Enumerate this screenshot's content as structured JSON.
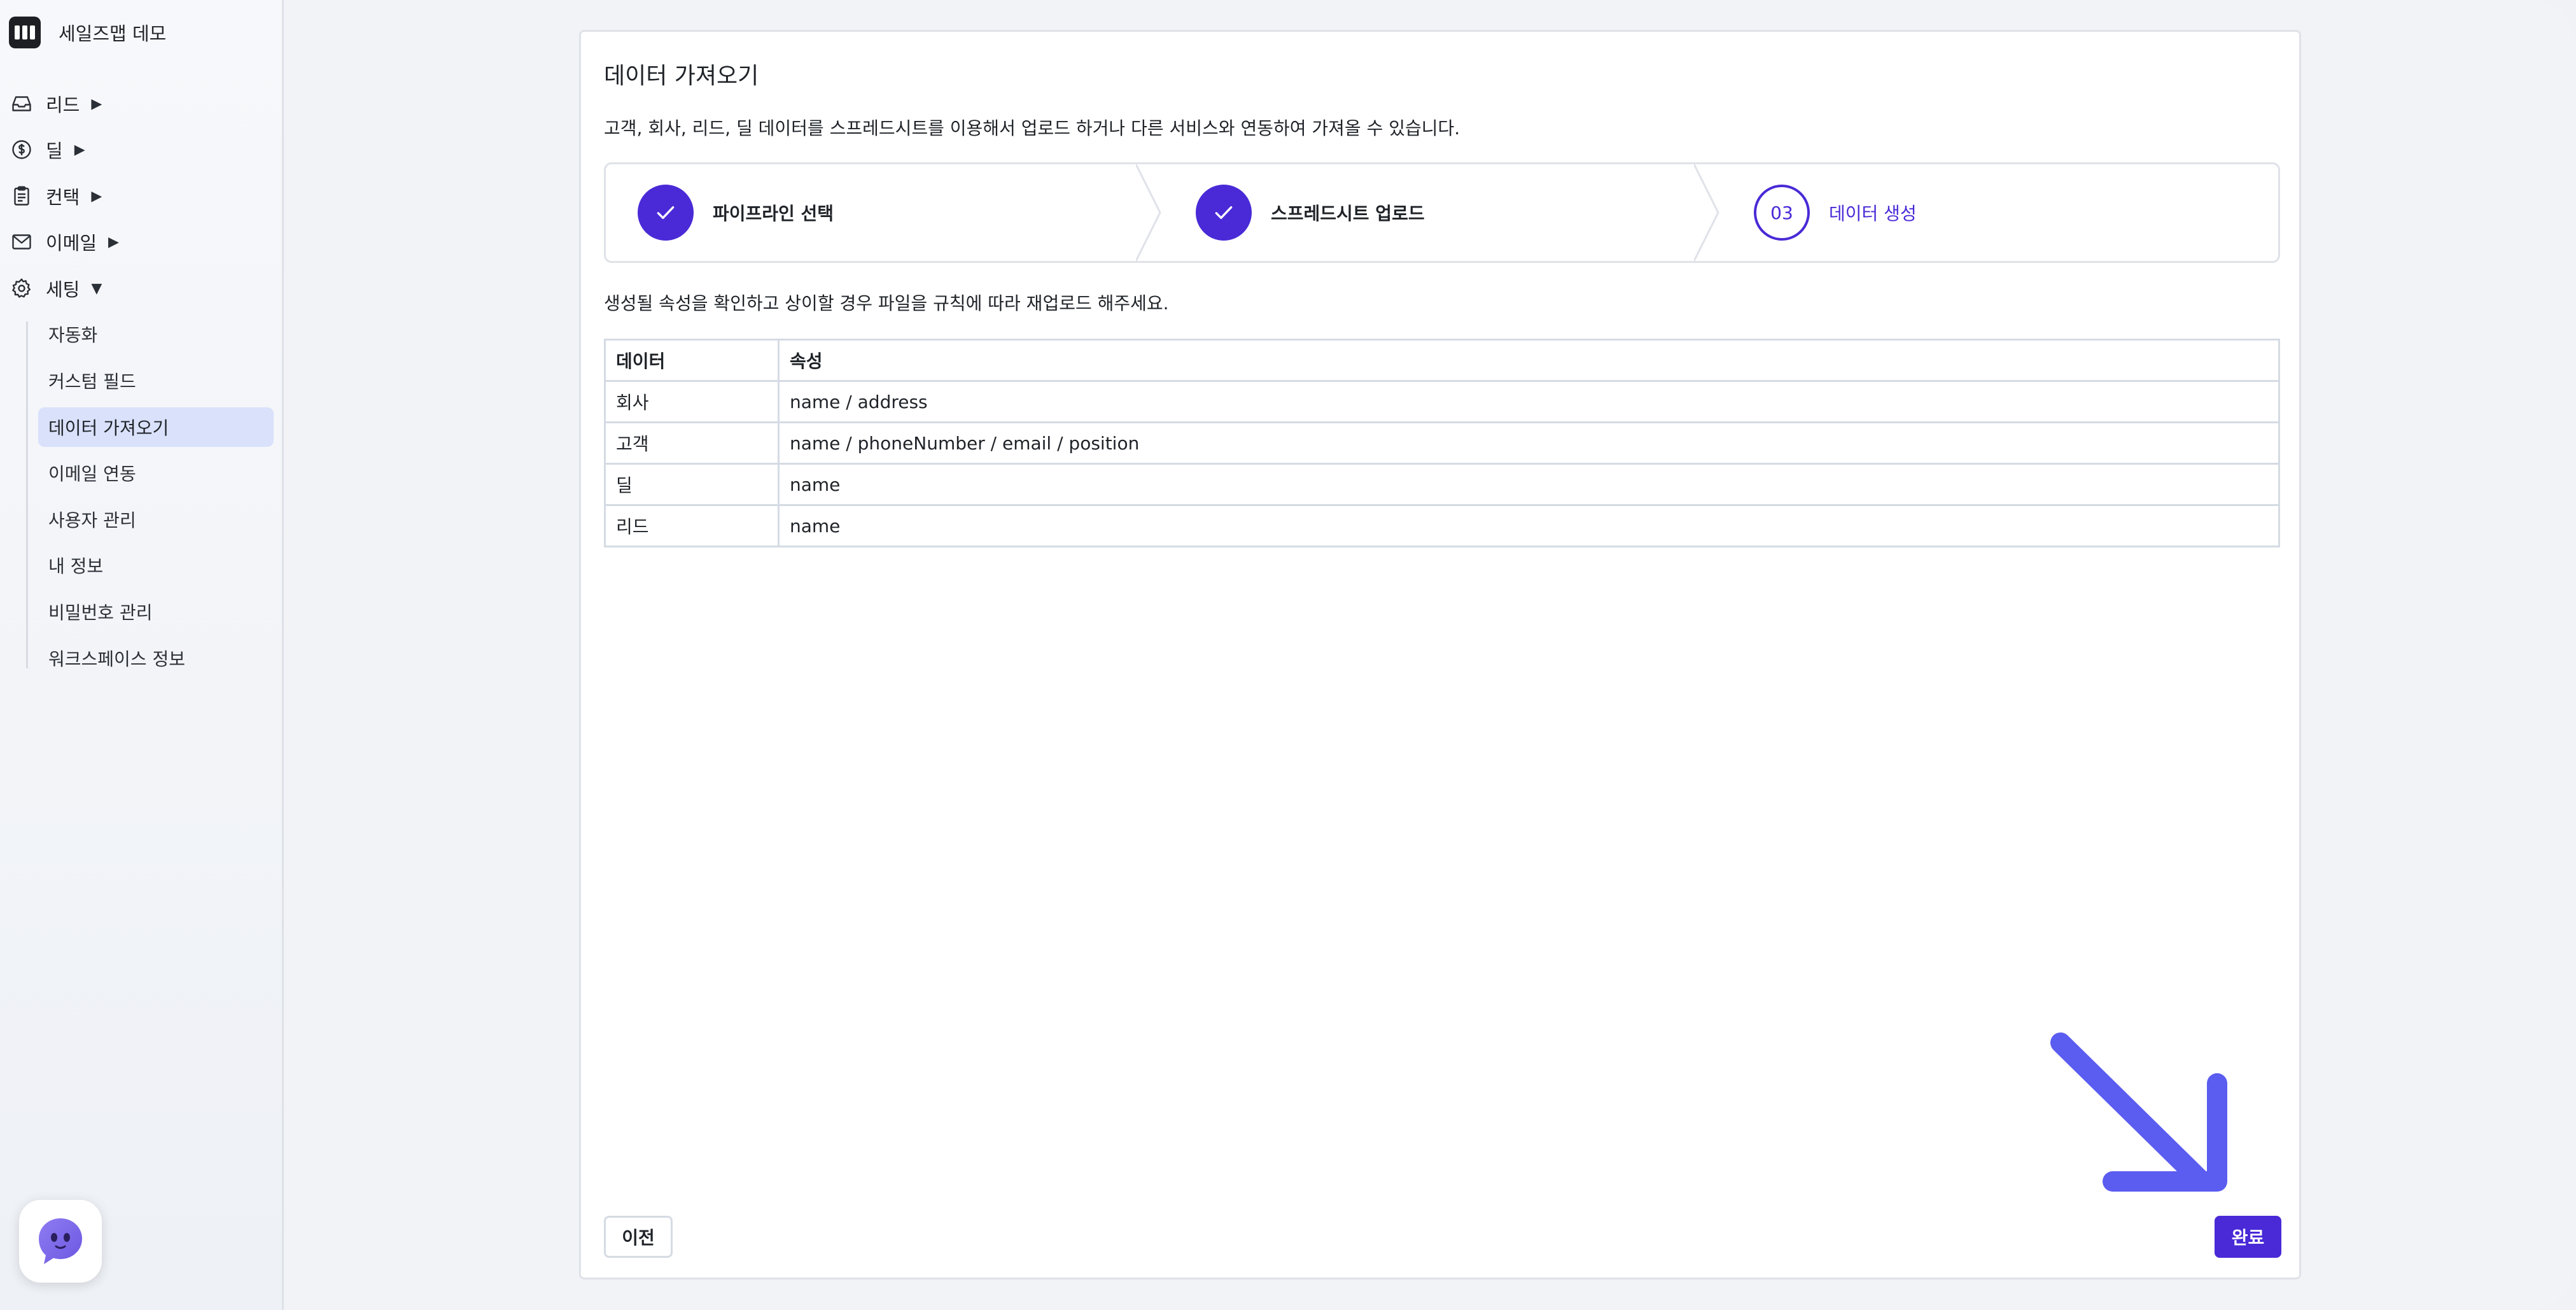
{
  "sidebar": {
    "brand": "세일즈맵 데모",
    "nav": [
      {
        "label": "리드",
        "arrow": "▶",
        "icon": "inbox-icon"
      },
      {
        "label": "딜",
        "arrow": "▶",
        "icon": "dollar-icon"
      },
      {
        "label": "컨택",
        "arrow": "▶",
        "icon": "clipboard-icon"
      },
      {
        "label": "이메일",
        "arrow": "▶",
        "icon": "mail-icon"
      },
      {
        "label": "세팅",
        "arrow": "▼",
        "icon": "gear-icon"
      }
    ],
    "settings_items": [
      {
        "label": "자동화"
      },
      {
        "label": "커스텀 필드"
      },
      {
        "label": "데이터 가져오기",
        "active": true
      },
      {
        "label": "이메일 연동"
      },
      {
        "label": "사용자 관리"
      },
      {
        "label": "내 정보"
      },
      {
        "label": "비밀번호 관리"
      },
      {
        "label": "워크스페이스 정보"
      }
    ]
  },
  "main": {
    "title": "데이터 가져오기",
    "description": "고객, 회사, 리드, 딜 데이터를 스프레드시트를 이용해서 업로드 하거나 다른 서비스와 연동하여 가져올 수 있습니다.",
    "steps": [
      {
        "label": "파이프라인 선택",
        "state": "done"
      },
      {
        "label": "스프레드시트 업로드",
        "state": "done"
      },
      {
        "label": "데이터 생성",
        "number": "03",
        "state": "current"
      }
    ],
    "hint": "생성될 속성을 확인하고 상이할 경우 파일을 규칙에 따라 재업로드 해주세요.",
    "table": {
      "headers": [
        "데이터",
        "속성"
      ],
      "rows": [
        [
          "회사",
          "name / address"
        ],
        [
          "고객",
          "name / phoneNumber / email / position"
        ],
        [
          "딜",
          "name"
        ],
        [
          "리드",
          "name"
        ]
      ]
    },
    "buttons": {
      "prev": "이전",
      "done": "완료"
    }
  },
  "colors": {
    "accent": "#4a2ad7",
    "active_bg": "#d9e1fb",
    "arrow": "#5b5cf0"
  }
}
